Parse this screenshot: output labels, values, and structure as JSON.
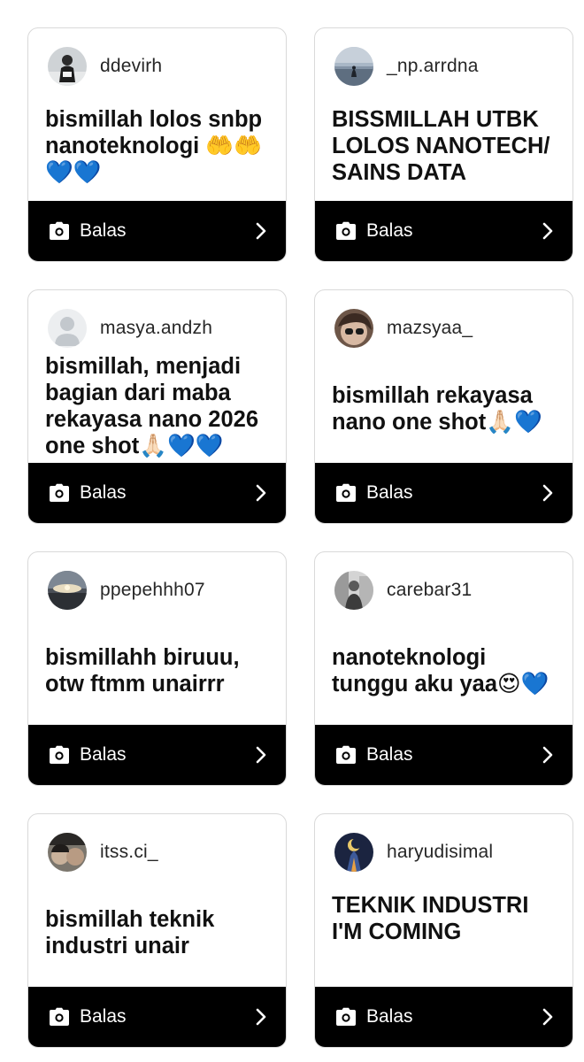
{
  "reply_label": "Balas",
  "cards": [
    {
      "username": "ddevirh",
      "message": "bismillah lolos snbp nanoteknologi 🤲🤲💙💙",
      "avatar": "avatar-person-dark"
    },
    {
      "username": "_np.arrdna",
      "message": "BISSMILLAH UTBK LOLOS NANOTECH/ SAINS DATA",
      "avatar": "avatar-sea-silhouette"
    },
    {
      "username": "masya.andzh",
      "message": "bismillah, menjadi bagian dari maba rekayasa nano 2026 one shot🙏🏻💙💙",
      "avatar": "avatar-default-person"
    },
    {
      "username": "mazsyaa_",
      "message": "bismillah rekayasa nano one shot🙏🏻💙",
      "avatar": "avatar-selfie-glasses"
    },
    {
      "username": "ppepehhh07",
      "message": "bismillahh biruuu, otw ftmm unairrr",
      "avatar": "avatar-sunset-sky"
    },
    {
      "username": "carebar31",
      "message": "nanoteknologi tunggu aku yaa😍💙",
      "avatar": "avatar-bw-photo"
    },
    {
      "username": "itss.ci_",
      "message": "bismillah teknik industri unair",
      "avatar": "avatar-two-faces"
    },
    {
      "username": "haryudisimal",
      "message": "TEKNIK INDUSTRI I'M COMING",
      "avatar": "avatar-night-art"
    }
  ]
}
